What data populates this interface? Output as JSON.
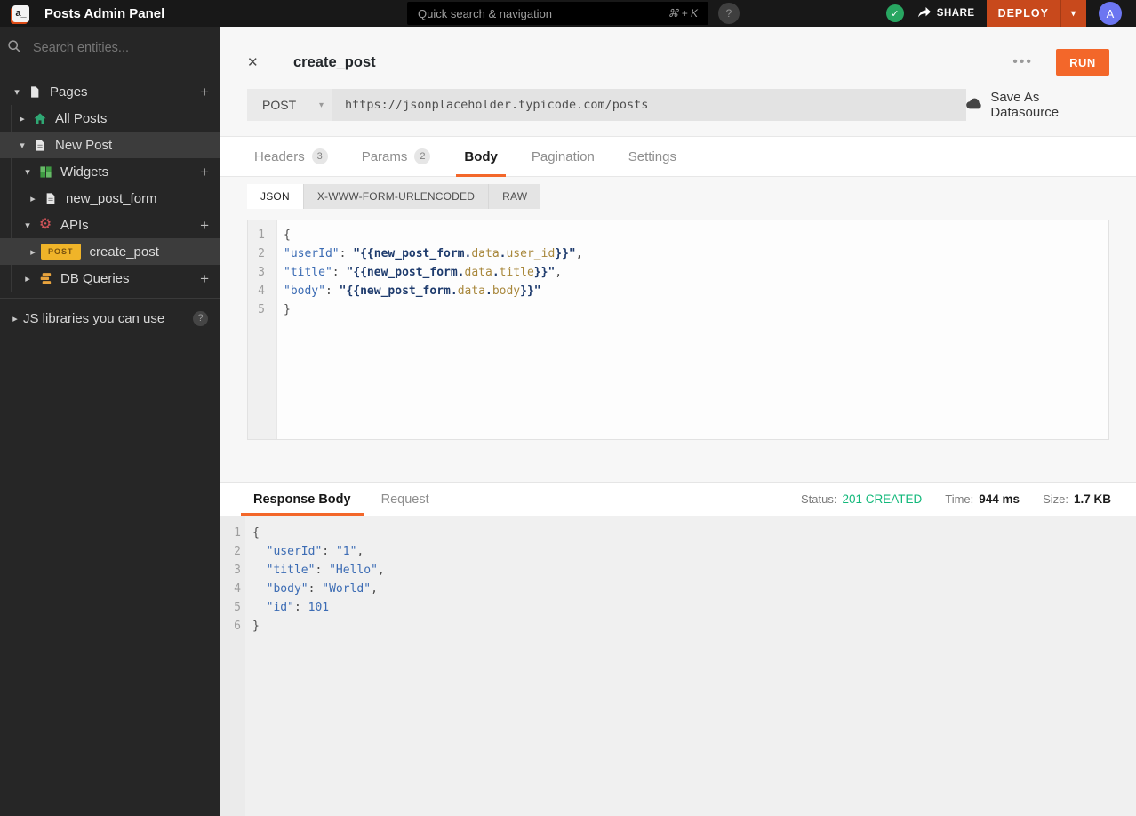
{
  "colors": {
    "accent-orange": "#F3672A",
    "deploy-orange": "#C8491C",
    "status-green": "#12B87A",
    "avatar-blue": "#6C76F1",
    "post-badge-yellow": "#F0B429",
    "topbar-bg": "#181818",
    "sidebar-bg": "#262626"
  },
  "glyphs": {
    "caret_down": "▾",
    "caret_right": "▸",
    "plus": "+",
    "close": "✕",
    "dots": "•••",
    "check": "✓",
    "help": "?",
    "shortcut": "⌘ + K"
  },
  "topbar": {
    "logo_text": "a_",
    "title": "Posts Admin Panel",
    "search_placeholder": "Quick search & navigation",
    "share_label": "SHARE",
    "deploy_label": "DEPLOY",
    "avatar_initial": "A"
  },
  "sidebar": {
    "search_placeholder": "Search entities...",
    "tree": [
      {
        "label": "Pages",
        "icon": "pages",
        "caret": "down",
        "indent": 0,
        "plus": true
      },
      {
        "label": "All Posts",
        "icon": "home",
        "caret": "right",
        "indent": 1
      },
      {
        "label": "New Post",
        "icon": "doc",
        "caret": "down",
        "indent": 1,
        "highlight": true
      },
      {
        "label": "Widgets",
        "icon": "widgets",
        "caret": "down",
        "indent": 2,
        "plus": true
      },
      {
        "label": "new_post_form",
        "icon": "doc",
        "caret": "right",
        "indent": 3
      },
      {
        "label": "APIs",
        "icon": "apis",
        "caret": "down",
        "indent": 2,
        "plus": true
      },
      {
        "label": "create_post",
        "badge": "POST",
        "caret": "right",
        "indent": 3,
        "highlight": true
      },
      {
        "label": "DB Queries",
        "icon": "db",
        "caret": "right",
        "indent": 2,
        "plus": true
      }
    ],
    "js_libraries_label": "JS libraries you can use"
  },
  "api": {
    "name": "create_post",
    "run_label": "RUN",
    "method": "POST",
    "url": "https://jsonplaceholder.typicode.com/posts",
    "save_as_label": "Save As Datasource"
  },
  "request_tabs": [
    {
      "label": "Headers",
      "badge": "3"
    },
    {
      "label": "Params",
      "badge": "2"
    },
    {
      "label": "Body",
      "active": true
    },
    {
      "label": "Pagination"
    },
    {
      "label": "Settings"
    }
  ],
  "body_format_tabs": [
    {
      "label": "JSON",
      "active": true
    },
    {
      "label": "X-WWW-FORM-URLENCODED"
    },
    {
      "label": "RAW"
    }
  ],
  "request_editor": {
    "lines": [
      {
        "n": 1,
        "tokens": [
          {
            "t": "{",
            "c": "p"
          }
        ]
      },
      {
        "n": 2,
        "tokens": [
          {
            "t": "\"userId\"",
            "c": "k"
          },
          {
            "t": ": ",
            "c": "p"
          },
          {
            "t": "\"{{new_post_form.",
            "c": "m"
          },
          {
            "t": "data",
            "c": "t"
          },
          {
            "t": ".",
            "c": "m"
          },
          {
            "t": "user_id",
            "c": "t"
          },
          {
            "t": "}}\"",
            "c": "m"
          },
          {
            "t": ",",
            "c": "p"
          }
        ]
      },
      {
        "n": 3,
        "tokens": [
          {
            "t": "\"title\"",
            "c": "k"
          },
          {
            "t": ": ",
            "c": "p"
          },
          {
            "t": "\"{{new_post_form.",
            "c": "m"
          },
          {
            "t": "data",
            "c": "t"
          },
          {
            "t": ".",
            "c": "m"
          },
          {
            "t": "title",
            "c": "t"
          },
          {
            "t": "}}\"",
            "c": "m"
          },
          {
            "t": ",",
            "c": "p"
          }
        ]
      },
      {
        "n": 4,
        "tokens": [
          {
            "t": "\"body\"",
            "c": "k"
          },
          {
            "t": ": ",
            "c": "p"
          },
          {
            "t": "\"{{new_post_form.",
            "c": "m"
          },
          {
            "t": "data",
            "c": "t"
          },
          {
            "t": ".",
            "c": "m"
          },
          {
            "t": "body",
            "c": "t"
          },
          {
            "t": "}}\"",
            "c": "m"
          }
        ]
      },
      {
        "n": 5,
        "tokens": [
          {
            "t": "}",
            "c": "p"
          }
        ]
      }
    ]
  },
  "response": {
    "tabs": [
      {
        "label": "Response Body",
        "active": true
      },
      {
        "label": "Request"
      }
    ],
    "status_label": "Status:",
    "status_value": "201 CREATED",
    "time_label": "Time:",
    "time_value": "944 ms",
    "size_label": "Size:",
    "size_value": "1.7 KB",
    "editor": {
      "lines": [
        {
          "n": 1,
          "tokens": [
            {
              "t": "{",
              "c": "p"
            }
          ]
        },
        {
          "n": 2,
          "tokens": [
            {
              "t": "  ",
              "c": "p"
            },
            {
              "t": "\"userId\"",
              "c": "k"
            },
            {
              "t": ": ",
              "c": "p"
            },
            {
              "t": "\"1\"",
              "c": "k"
            },
            {
              "t": ",",
              "c": "p"
            }
          ]
        },
        {
          "n": 3,
          "tokens": [
            {
              "t": "  ",
              "c": "p"
            },
            {
              "t": "\"title\"",
              "c": "k"
            },
            {
              "t": ": ",
              "c": "p"
            },
            {
              "t": "\"Hello\"",
              "c": "k"
            },
            {
              "t": ",",
              "c": "p"
            }
          ]
        },
        {
          "n": 4,
          "tokens": [
            {
              "t": "  ",
              "c": "p"
            },
            {
              "t": "\"body\"",
              "c": "k"
            },
            {
              "t": ": ",
              "c": "p"
            },
            {
              "t": "\"World\"",
              "c": "k"
            },
            {
              "t": ",",
              "c": "p"
            }
          ]
        },
        {
          "n": 5,
          "tokens": [
            {
              "t": "  ",
              "c": "p"
            },
            {
              "t": "\"id\"",
              "c": "k"
            },
            {
              "t": ": ",
              "c": "p"
            },
            {
              "t": "101",
              "c": "k"
            }
          ]
        },
        {
          "n": 6,
          "tokens": [
            {
              "t": "}",
              "c": "p"
            }
          ]
        }
      ]
    }
  }
}
